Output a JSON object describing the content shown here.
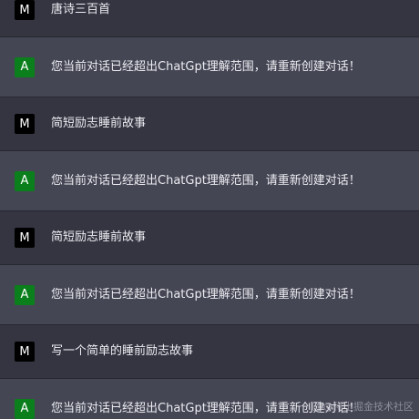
{
  "colors": {
    "page_background": "#343541",
    "assistant_row_background": "#444654",
    "user_avatar": "#000000",
    "assistant_avatar": "#0a7f1b",
    "text": "#ececf1"
  },
  "messages": [
    {
      "role": "user",
      "avatar": "M",
      "text": "唐诗三百首"
    },
    {
      "role": "assistant",
      "avatar": "A",
      "text": "您当前对话已经超出ChatGpt理解范围，请重新创建对话！"
    },
    {
      "role": "user",
      "avatar": "M",
      "text": "简短励志睡前故事"
    },
    {
      "role": "assistant",
      "avatar": "A",
      "text": "您当前对话已经超出ChatGpt理解范围，请重新创建对话！"
    },
    {
      "role": "user",
      "avatar": "M",
      "text": "简短励志睡前故事"
    },
    {
      "role": "assistant",
      "avatar": "A",
      "text": "您当前对话已经超出ChatGpt理解范围，请重新创建对话！"
    },
    {
      "role": "user",
      "avatar": "M",
      "text": "写一个简单的睡前励志故事"
    },
    {
      "role": "assistant",
      "avatar": "A",
      "text": "您当前对话已经超出ChatGpt理解范围，请重新创建对话！"
    }
  ],
  "watermark": {
    "text": "@稀土掘金技术社区",
    "icon": "juejin-logo-icon"
  }
}
